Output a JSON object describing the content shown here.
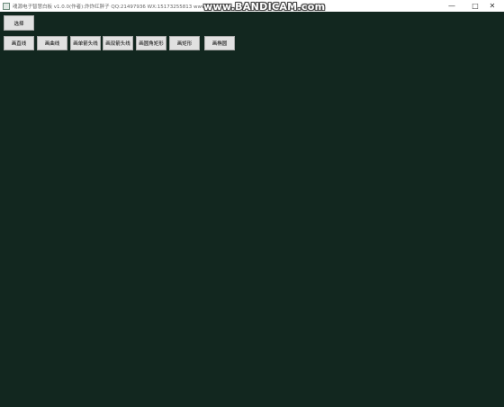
{
  "window": {
    "title": "魂源电子智慧白板 v1.0.0(作者):炸炸红胖子 QQ:21497936 WX:15173255813 www.hpzwl.com",
    "watermark": "www.BANDICAM.com",
    "minimize_icon": "minimize-icon",
    "maximize_icon": "maximize-icon",
    "close_icon": "close-icon"
  },
  "toolbar": {
    "select_label": "选择",
    "buttons": [
      {
        "label": "画直线"
      },
      {
        "label": "画曲线"
      },
      {
        "label": "画单箭头线"
      },
      {
        "label": "画双箭头线"
      },
      {
        "label": "画圆角矩形"
      },
      {
        "label": "画矩形"
      },
      {
        "label": "画椭圆"
      }
    ]
  },
  "colors": {
    "canvas_background": "#12271f",
    "button_background": "#e1e1e1",
    "button_border": "#adadad"
  }
}
